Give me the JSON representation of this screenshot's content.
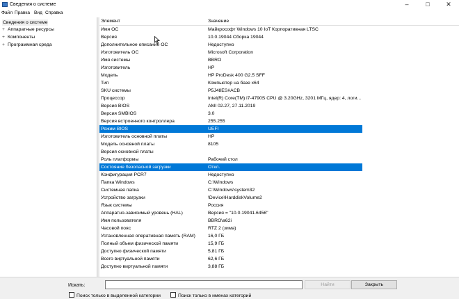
{
  "window": {
    "title": "Сведения о системе"
  },
  "menu": [
    "Файл",
    "Правка",
    "Вид",
    "Справка"
  ],
  "tree": {
    "root": "Сведения о системе",
    "items": [
      "Аппаратные ресурсы",
      "Компоненты",
      "Программная среда"
    ],
    "expander": "+"
  },
  "table": {
    "headers": [
      "Элемент",
      "Значение"
    ],
    "rows": [
      {
        "k": "Имя ОС",
        "v": "Майкрософт Windows 10 IoT Корпоративная LTSC"
      },
      {
        "k": "Версия",
        "v": "10.0.19044 Сборка 19044"
      },
      {
        "k": "Дополнительное описание ОС",
        "v": "Недоступно"
      },
      {
        "k": "Изготовитель ОС",
        "v": "Microsoft Corporation"
      },
      {
        "k": "Имя системы",
        "v": "BBRO"
      },
      {
        "k": "Изготовитель",
        "v": "HP"
      },
      {
        "k": "Модель",
        "v": "HP ProDesk 400 G2.5 SFF"
      },
      {
        "k": "Тип",
        "v": "Компьютер на базе x64"
      },
      {
        "k": "SKU системы",
        "v": "P5J48ES#ACB"
      },
      {
        "k": "Процессор",
        "v": "Intel(R) Core(TM) i7-4790S CPU @ 3.20GHz, 3201 МГц, ядер: 4, логи..."
      },
      {
        "k": "Версия BIOS",
        "v": "AMI 02.27, 27.11.2019"
      },
      {
        "k": "Версия SMBIOS",
        "v": "3.0"
      },
      {
        "k": "Версия встроенного контроллера",
        "v": "255.255"
      },
      {
        "k": "Режим BIOS",
        "v": "UEFI"
      },
      {
        "k": "Изготовитель основной платы",
        "v": "HP"
      },
      {
        "k": "Модель основной платы",
        "v": "8105"
      },
      {
        "k": "Версия основной платы",
        "v": ""
      },
      {
        "k": "Роль платформы",
        "v": "Рабочий стол"
      },
      {
        "k": "Состояние безопасной загрузки",
        "v": "Откл."
      },
      {
        "k": "Конфигурация PCR7",
        "v": "Недоступно"
      },
      {
        "k": "Папка Windows",
        "v": "C:\\Windows"
      },
      {
        "k": "Системная папка",
        "v": "C:\\Windows\\system32"
      },
      {
        "k": "Устройство загрузки",
        "v": "\\Device\\HarddiskVolume2"
      },
      {
        "k": "Язык системы",
        "v": "Россия"
      },
      {
        "k": "Аппаратно-зависимый уровень (HAL)",
        "v": "Версия = \"10.0.19041.6456\""
      },
      {
        "k": "Имя пользователя",
        "v": "BBRO\\a62i"
      },
      {
        "k": "Часовой пояс",
        "v": "RTZ 2 (зима)"
      },
      {
        "k": "Установленная оперативная память (RAM)",
        "v": "16,0 ГБ"
      },
      {
        "k": "Полный объем физической памяти",
        "v": "15,9 ГБ"
      },
      {
        "k": "Доступно физической памяти",
        "v": "5,81 ГБ"
      },
      {
        "k": "Всего виртуальной памяти",
        "v": "62,6 ГБ"
      },
      {
        "k": "Доступно виртуальной памяти",
        "v": "3,88 ГБ"
      }
    ],
    "selected_rows": [
      13,
      18
    ]
  },
  "search": {
    "label": "Искать:",
    "value": "",
    "find_button": "Найти",
    "close_button": "Закрыть",
    "check_selected_category": "Поиск только в выделенной категории",
    "check_category_names": "Поиск только в именах категорий"
  },
  "colors": {
    "selection": "#0078d7"
  }
}
